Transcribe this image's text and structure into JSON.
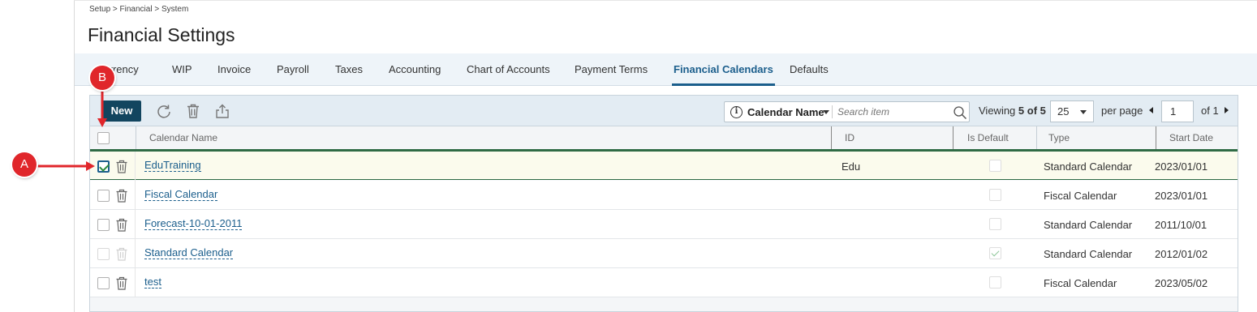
{
  "breadcrumb": "Setup > Financial > System",
  "page_title": "Financial Settings",
  "tabs": [
    {
      "label": "Currency",
      "active": false
    },
    {
      "label": "WIP",
      "active": false
    },
    {
      "label": "Invoice",
      "active": false
    },
    {
      "label": "Payroll",
      "active": false
    },
    {
      "label": "Taxes",
      "active": false
    },
    {
      "label": "Accounting",
      "active": false
    },
    {
      "label": "Chart of Accounts",
      "active": false
    },
    {
      "label": "Payment Terms",
      "active": false
    },
    {
      "label": "Financial Calendars",
      "active": true
    },
    {
      "label": "Defaults",
      "active": false
    }
  ],
  "toolbar": {
    "new_label": "New",
    "icons": [
      "refresh-icon",
      "delete-icon",
      "export-icon"
    ],
    "search_field": "Calendar Name",
    "search_placeholder": "Search item",
    "viewing_label": "Viewing",
    "viewing_count": "5 of 5",
    "per_page_value": "25",
    "per_page_label": "per page",
    "page_value": "1",
    "of_pages": "of 1"
  },
  "grid": {
    "columns": [
      "Calendar Name",
      "ID",
      "Is Default",
      "Type",
      "Start Date"
    ],
    "rows": [
      {
        "name": "EduTraining",
        "id": "Edu",
        "is_default": false,
        "type": "Standard Calendar",
        "start": "2023/01/01",
        "selected": true,
        "disabled": false
      },
      {
        "name": "Fiscal Calendar",
        "id": "",
        "is_default": false,
        "type": "Fiscal Calendar",
        "start": "2023/01/01",
        "selected": false,
        "disabled": false
      },
      {
        "name": "Forecast-10-01-2011",
        "id": "",
        "is_default": false,
        "type": "Standard Calendar",
        "start": "2011/10/01",
        "selected": false,
        "disabled": false
      },
      {
        "name": "Standard Calendar",
        "id": "",
        "is_default": true,
        "type": "Standard Calendar",
        "start": "2012/01/02",
        "selected": false,
        "disabled": true
      },
      {
        "name": "test",
        "id": "",
        "is_default": false,
        "type": "Fiscal Calendar",
        "start": "2023/05/02",
        "selected": false,
        "disabled": false
      }
    ]
  },
  "callouts": {
    "a": "A",
    "b": "B"
  },
  "colors": {
    "accent": "#1b5e8c",
    "new_button": "#12455f",
    "callout": "#e0262b",
    "selected_row_border": "#2f6b45"
  }
}
